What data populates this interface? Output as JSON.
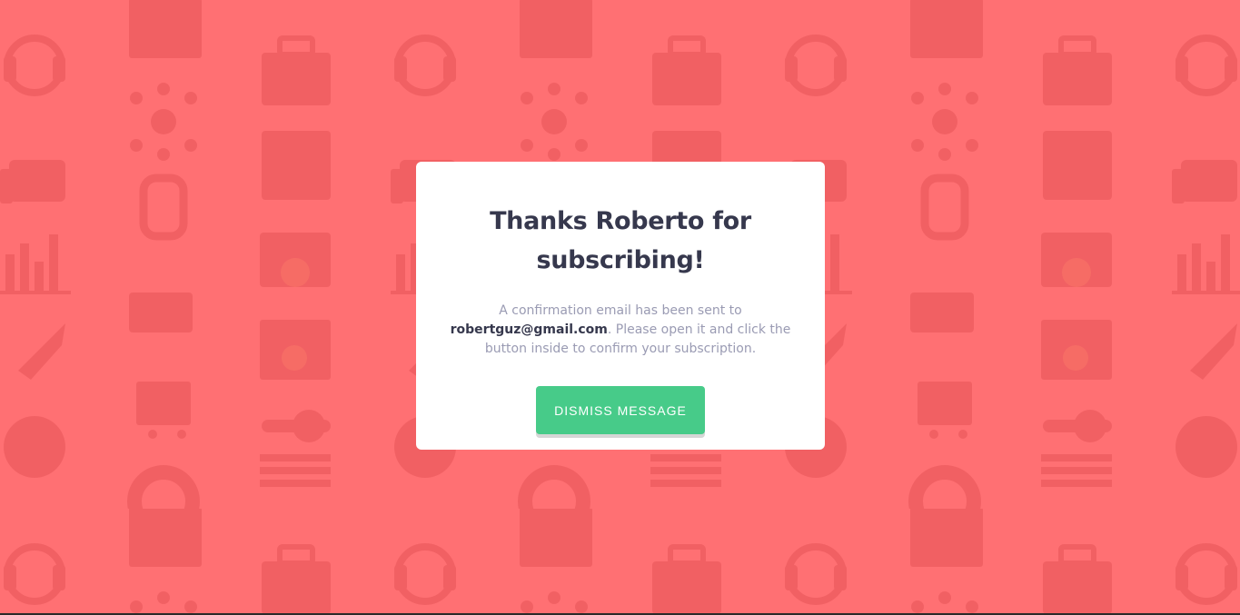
{
  "colors": {
    "background": "#ff7073",
    "pattern_icons": "#ee5c5f",
    "card": "#ffffff",
    "title_text": "#36384d",
    "body_text": "#9a9bb3",
    "button": "#47cb89"
  },
  "background_pattern": {
    "icons": [
      "upload-window-icon",
      "headset-icon",
      "toolbox-icon",
      "network-icon",
      "thumbs-up-icon",
      "chart-icon",
      "gear-folder-icon",
      "rocket-icon",
      "search-window-icon",
      "cart-icon",
      "globe-gear-icon",
      "lifebuoy-icon",
      "calendar-icon",
      "lightbulb-icon",
      "key-icon",
      "document-icon"
    ]
  },
  "modal": {
    "title": "Thanks Roberto for subscribing!",
    "message_before": "A confirmation email has been sent to ",
    "email": "robertguz@gmail.com",
    "message_after": ". Please open it and click the button inside to confirm your subscription.",
    "dismiss_label": "Dismiss message"
  }
}
